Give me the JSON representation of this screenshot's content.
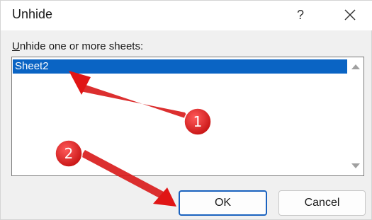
{
  "dialog": {
    "title": "Unhide",
    "help_label": "?",
    "close_icon": "close-icon",
    "prompt_accel": "U",
    "prompt_rest": "nhide one or more sheets:"
  },
  "sheets_list": {
    "items": [
      "Sheet2"
    ],
    "selected": "Sheet2"
  },
  "buttons": {
    "ok": "OK",
    "cancel": "Cancel"
  },
  "annotations": {
    "marker_1": "1",
    "marker_2": "2",
    "marker_color": "#e02020",
    "arrow_color": "#e01515"
  },
  "colors": {
    "selection": "#0a64c4",
    "ok_border": "#1a62bf"
  }
}
